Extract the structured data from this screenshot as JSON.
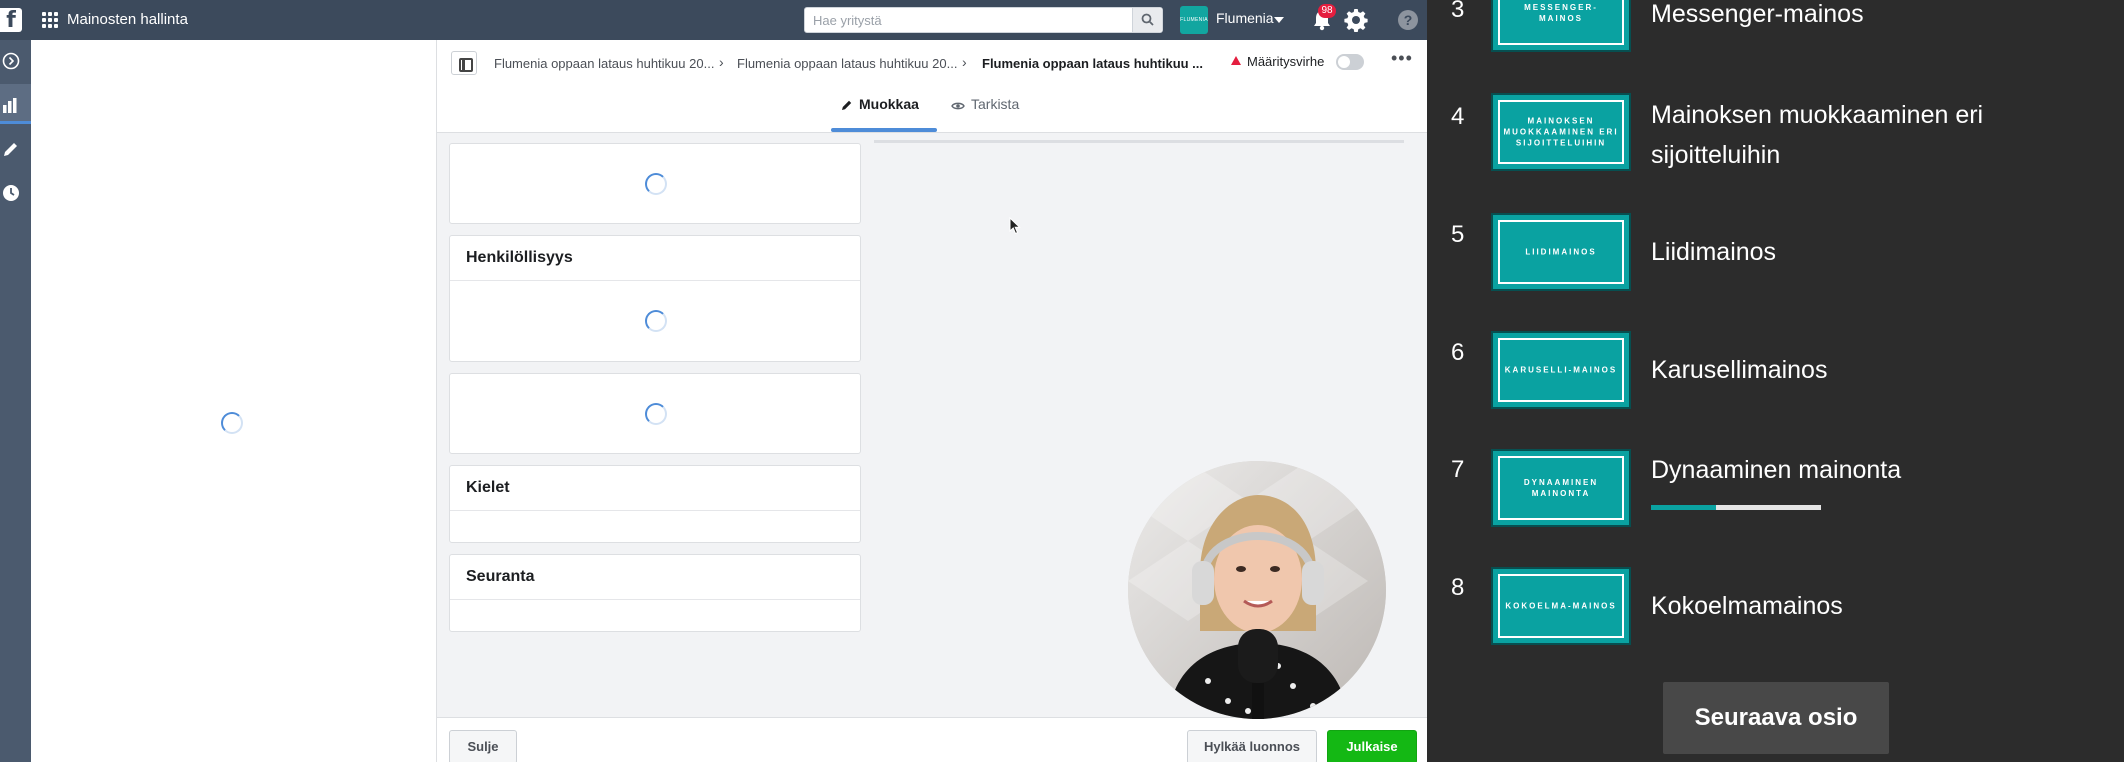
{
  "topbar": {
    "app_title": "Mainosten hallinta",
    "search_placeholder": "Hae yritystä",
    "account_logo_text": "FLUMENIA",
    "account_name": "Flumenia",
    "notification_count": "98",
    "help_label": "?"
  },
  "breadcrumb": {
    "campaign": "Flumenia oppaan lataus huhtikuu 20...",
    "adset": "Flumenia oppaan lataus huhtikuu 20...",
    "ad": "Flumenia oppaan lataus huhtikuu ..."
  },
  "status": {
    "error_label": "Määritysvirhe"
  },
  "tabs": [
    {
      "label": "Muokkaa",
      "active": true
    },
    {
      "label": "Tarkista",
      "active": false
    }
  ],
  "cards": {
    "identity_title": "Henkilöllisyys",
    "languages_title": "Kielet",
    "tracking_title": "Seuranta"
  },
  "footer": {
    "close_label": "Sulje",
    "discard_label": "Hylkää luonnos",
    "publish_label": "Julkaise"
  },
  "course": {
    "lessons": [
      {
        "number": "3",
        "thumb": "MESSENGER-MAINOS",
        "title": "Messenger-mainos"
      },
      {
        "number": "4",
        "thumb": "MAINOKSEN MUOKKAAMINEN ERI SIJOITTELUIHIN",
        "title": "Mainoksen muokkaaminen eri sijoitteluihin"
      },
      {
        "number": "5",
        "thumb": "LIIDIMAINOS",
        "title": "Liidimainos"
      },
      {
        "number": "6",
        "thumb": "KARUSELLI-MAINOS",
        "title": "Karusellimainos"
      },
      {
        "number": "7",
        "thumb": "DYNAAMINEN MAINONTA",
        "title": "Dynaaminen mainonta",
        "progress": 0.38
      },
      {
        "number": "8",
        "thumb": "KOKOELMA-MAINOS",
        "title": "Kokoelmamainos"
      }
    ],
    "next_label": "Seuraava osio"
  },
  "colors": {
    "topbar": "#3c4a5c",
    "accent_blue": "#4e8cd8",
    "publish_green": "#14b814",
    "course_teal": "#0aa2a1"
  }
}
